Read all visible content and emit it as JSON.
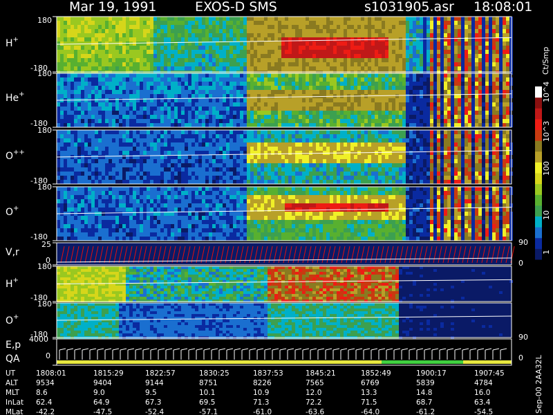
{
  "title": {
    "date": "Mar 19, 1991",
    "instrument": "EXOS-D SMS",
    "file": "s1031905.asr",
    "time": "18:08:01"
  },
  "colorbar": {
    "unit": "Ct/Smp",
    "scale": "log",
    "ticks": [
      "1",
      "10",
      "100",
      "10^3",
      "10^4"
    ],
    "colors": [
      "#0a1a66",
      "#0a2aa0",
      "#1a6fd0",
      "#00b0c8",
      "#3ca050",
      "#58b030",
      "#9ac820",
      "#d6d61a",
      "#f0f028",
      "#b8a028",
      "#8a7a20",
      "#c83a10",
      "#ee1c14",
      "#c01818",
      "#8a1010",
      "#fefefe"
    ]
  },
  "footer_note": "Sep-00 2AA32L",
  "chart_data": [
    {
      "type": "heatmap",
      "panel": "H+",
      "species_base": "H",
      "species_sup": "+",
      "y_range": [
        -180,
        180
      ],
      "y_ticks": [
        "180",
        "-180"
      ]
    },
    {
      "type": "heatmap",
      "panel": "He+",
      "species_base": "He",
      "species_sup": "+",
      "y_range": [
        -180,
        180
      ],
      "y_ticks": [
        "180",
        "-180"
      ]
    },
    {
      "type": "heatmap",
      "panel": "O++",
      "species_base": "O",
      "species_sup": "++",
      "y_range": [
        -180,
        180
      ],
      "y_ticks": [
        "180",
        "-180"
      ]
    },
    {
      "type": "heatmap",
      "panel": "O+",
      "species_base": "O",
      "species_sup": "+",
      "y_range": [
        -180,
        180
      ],
      "y_ticks": [
        "180",
        "-180"
      ]
    },
    {
      "type": "line",
      "panel": "V,r",
      "label": "V,r",
      "y_left_ticks": [
        "25",
        "0"
      ],
      "y_right_ticks": [
        "90",
        "0"
      ]
    },
    {
      "type": "heatmap",
      "panel": "H+ (2)",
      "species_base": "H",
      "species_sup": "+",
      "y_range": [
        -180,
        180
      ],
      "y_ticks": [
        "180",
        "-180"
      ]
    },
    {
      "type": "heatmap",
      "panel": "O+ (2)",
      "species_base": "O",
      "species_sup": "+",
      "y_range": [
        -180,
        180
      ],
      "y_ticks": [
        "180",
        "-180"
      ],
      "y_right_ticks": [
        "90"
      ]
    },
    {
      "type": "line",
      "panel": "E,p / QA",
      "label1": "E,p",
      "label2": "QA",
      "y_left_ticks": [
        "4000",
        "0"
      ],
      "y_right_ticks": [
        "0"
      ]
    }
  ],
  "ephemeris": {
    "rows": [
      {
        "label": "UT",
        "values": [
          "1808:01",
          "1815:29",
          "1822:57",
          "1830:25",
          "1837:53",
          "1845:21",
          "1852:49",
          "1900:17",
          "1907:45"
        ]
      },
      {
        "label": "ALT",
        "values": [
          "9534",
          "9404",
          "9144",
          "8751",
          "8226",
          "7565",
          "6769",
          "5839",
          "4784"
        ]
      },
      {
        "label": "MLT",
        "values": [
          "8.6",
          "9.0",
          "9.5",
          "10.1",
          "10.9",
          "12.0",
          "13.3",
          "14.8",
          "16.0"
        ]
      },
      {
        "label": "InLat",
        "values": [
          "62.4",
          "64.9",
          "67.3",
          "69.5",
          "71.3",
          "72.2",
          "71.5",
          "68.7",
          "63.4"
        ]
      },
      {
        "label": "MLat",
        "values": [
          "-42.2",
          "-47.5",
          "-52.4",
          "-57.1",
          "-61.0",
          "-63.6",
          "-64.0",
          "-61.2",
          "-54.5"
        ]
      }
    ]
  }
}
